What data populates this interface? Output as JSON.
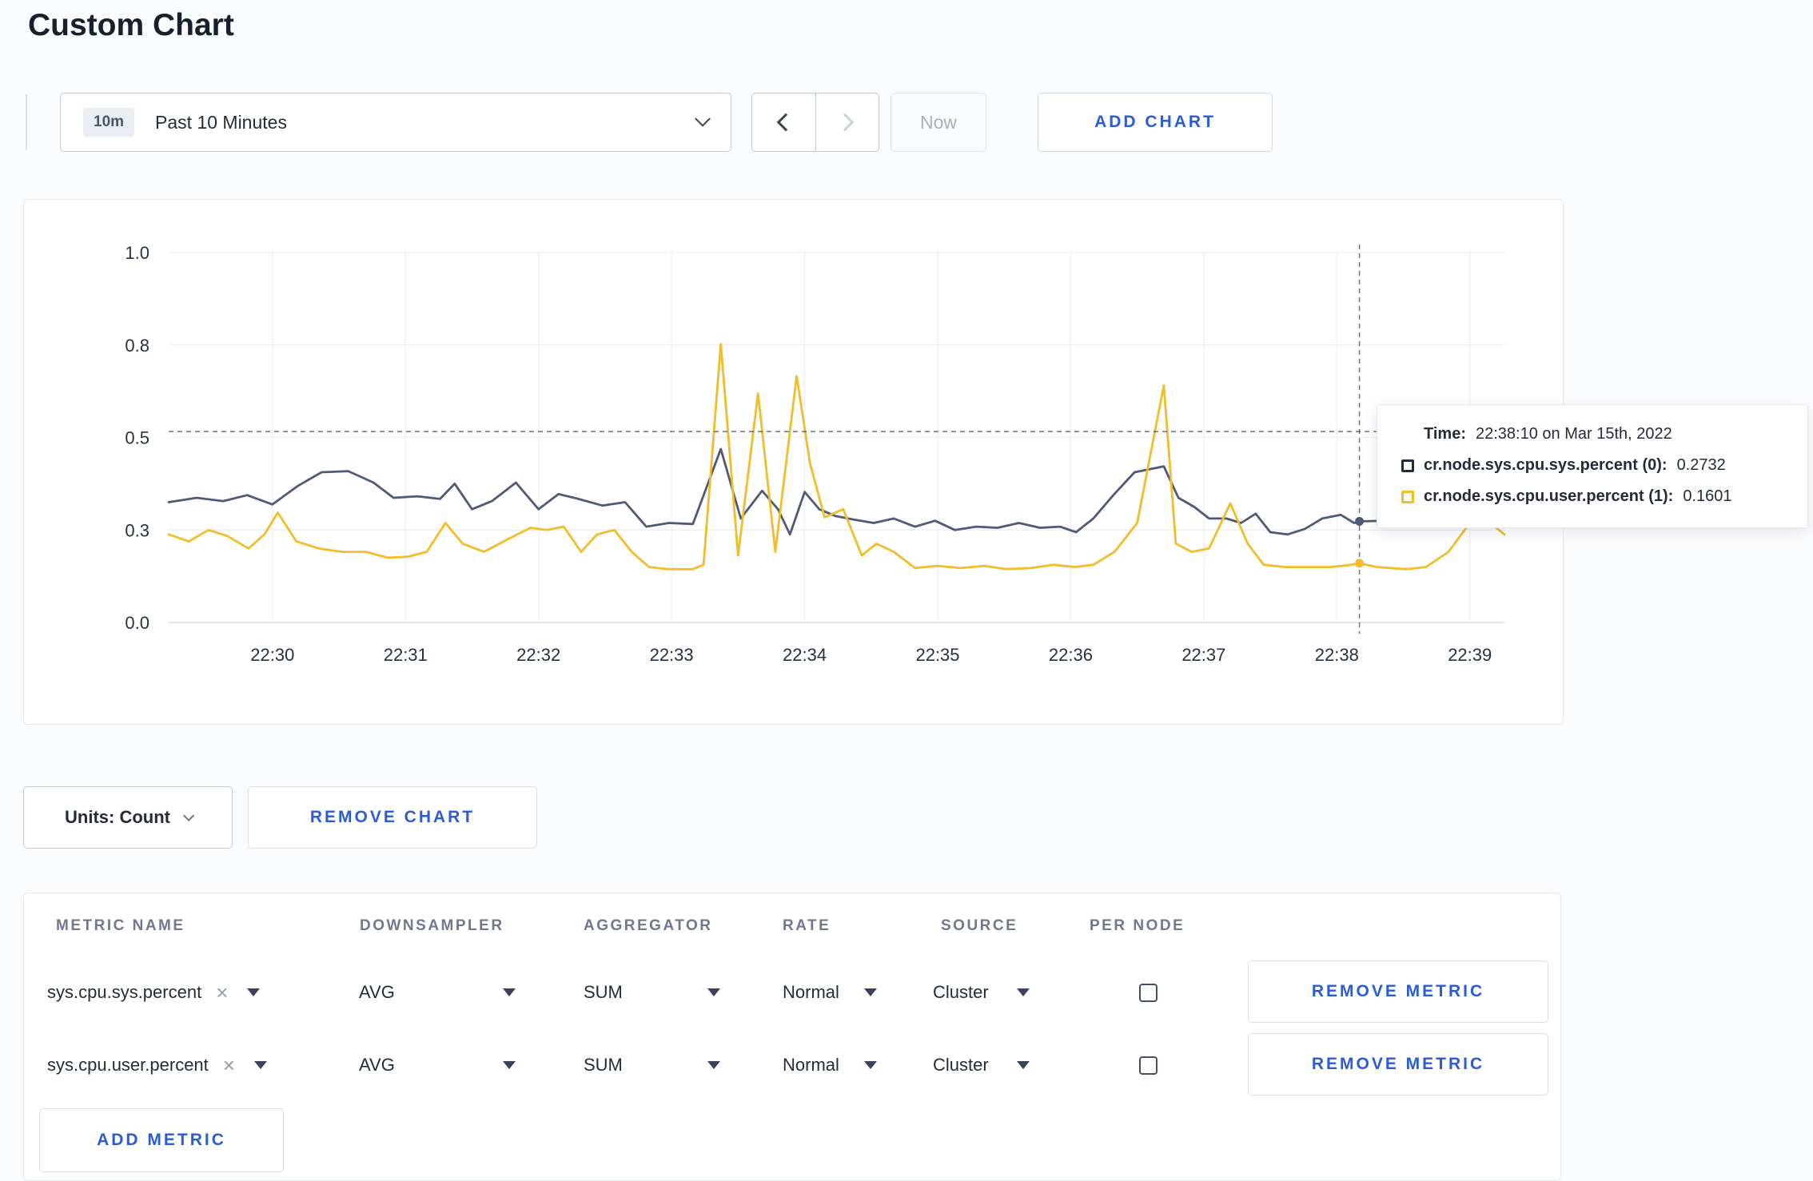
{
  "page": {
    "title": "Custom Chart"
  },
  "colors": {
    "accent": "#2b5bd7",
    "series_sys": "#4e5a78",
    "series_user": "#f2bd2a"
  },
  "toolbar": {
    "time_range": {
      "badge": "10m",
      "label": "Past 10 Minutes"
    },
    "now_label": "Now",
    "add_chart_label": "ADD CHART"
  },
  "chart": {
    "tooltip": {
      "time_label": "Time:",
      "time_value": "22:38:10 on Mar 15th, 2022",
      "series": [
        {
          "label": "cr.node.sys.cpu.sys.percent (0):",
          "value": "0.2732"
        },
        {
          "label": "cr.node.sys.cpu.user.percent (1):",
          "value": "0.1601"
        }
      ]
    }
  },
  "chart_data": {
    "type": "line",
    "title": "",
    "x_ticks": [
      "22:30",
      "22:31",
      "22:32",
      "22:33",
      "22:34",
      "22:35",
      "22:36",
      "22:37",
      "22:38",
      "22:39"
    ],
    "x_domain_minutes": [
      -0.78,
      9.26
    ],
    "y_domain": [
      0,
      1
    ],
    "y_ticks": {
      "values": [
        0,
        0.25,
        0.5,
        0.75,
        1.0
      ],
      "labels": [
        "0.0",
        "0.3",
        "0.5",
        "0.8",
        "1.0"
      ]
    },
    "grid": true,
    "series": [
      {
        "name": "cr.node.sys.cpu.sys.percent",
        "color": "#4e5a78",
        "points": [
          [
            -0.78,
            0.325
          ],
          [
            -0.57,
            0.337
          ],
          [
            -0.37,
            0.328
          ],
          [
            -0.19,
            0.344
          ],
          [
            0,
            0.319
          ],
          [
            0.19,
            0.369
          ],
          [
            0.37,
            0.406
          ],
          [
            0.57,
            0.409
          ],
          [
            0.76,
            0.378
          ],
          [
            0.91,
            0.337
          ],
          [
            1.09,
            0.341
          ],
          [
            1.26,
            0.334
          ],
          [
            1.37,
            0.375
          ],
          [
            1.5,
            0.306
          ],
          [
            1.65,
            0.328
          ],
          [
            1.83,
            0.378
          ],
          [
            2,
            0.306
          ],
          [
            2.15,
            0.347
          ],
          [
            2.3,
            0.334
          ],
          [
            2.48,
            0.316
          ],
          [
            2.65,
            0.325
          ],
          [
            2.81,
            0.259
          ],
          [
            2.98,
            0.269
          ],
          [
            3.16,
            0.266
          ],
          [
            3.37,
            0.469
          ],
          [
            3.52,
            0.281
          ],
          [
            3.68,
            0.356
          ],
          [
            3.8,
            0.306
          ],
          [
            3.89,
            0.238
          ],
          [
            4,
            0.353
          ],
          [
            4.11,
            0.306
          ],
          [
            4.23,
            0.288
          ],
          [
            4.37,
            0.278
          ],
          [
            4.52,
            0.269
          ],
          [
            4.67,
            0.281
          ],
          [
            4.83,
            0.259
          ],
          [
            4.98,
            0.275
          ],
          [
            5.13,
            0.25
          ],
          [
            5.29,
            0.259
          ],
          [
            5.45,
            0.256
          ],
          [
            5.61,
            0.269
          ],
          [
            5.77,
            0.256
          ],
          [
            5.92,
            0.259
          ],
          [
            6.04,
            0.244
          ],
          [
            6.17,
            0.281
          ],
          [
            6.32,
            0.344
          ],
          [
            6.48,
            0.406
          ],
          [
            6.7,
            0.422
          ],
          [
            6.81,
            0.337
          ],
          [
            6.93,
            0.312
          ],
          [
            7.04,
            0.281
          ],
          [
            7.17,
            0.281
          ],
          [
            7.28,
            0.269
          ],
          [
            7.39,
            0.294
          ],
          [
            7.5,
            0.244
          ],
          [
            7.63,
            0.238
          ],
          [
            7.76,
            0.253
          ],
          [
            7.89,
            0.281
          ],
          [
            8.03,
            0.291
          ],
          [
            8.13,
            0.269
          ],
          [
            8.17,
            0.2732
          ],
          [
            8.36,
            0.275
          ],
          [
            8.52,
            0.266
          ],
          [
            8.7,
            0.259
          ],
          [
            8.87,
            0.275
          ],
          [
            9,
            0.288
          ],
          [
            9.13,
            0.281
          ],
          [
            9.26,
            0.291
          ]
        ]
      },
      {
        "name": "cr.node.sys.cpu.user.percent",
        "color": "#f2bd2a",
        "points": [
          [
            -0.78,
            0.238
          ],
          [
            -0.63,
            0.219
          ],
          [
            -0.48,
            0.25
          ],
          [
            -0.34,
            0.234
          ],
          [
            -0.18,
            0.2
          ],
          [
            -0.06,
            0.238
          ],
          [
            0.04,
            0.297
          ],
          [
            0.18,
            0.219
          ],
          [
            0.35,
            0.2
          ],
          [
            0.52,
            0.191
          ],
          [
            0.7,
            0.191
          ],
          [
            0.87,
            0.175
          ],
          [
            1.02,
            0.178
          ],
          [
            1.16,
            0.191
          ],
          [
            1.3,
            0.269
          ],
          [
            1.43,
            0.213
          ],
          [
            1.59,
            0.191
          ],
          [
            1.77,
            0.225
          ],
          [
            1.94,
            0.256
          ],
          [
            2.06,
            0.25
          ],
          [
            2.19,
            0.259
          ],
          [
            2.32,
            0.191
          ],
          [
            2.44,
            0.238
          ],
          [
            2.57,
            0.25
          ],
          [
            2.7,
            0.191
          ],
          [
            2.83,
            0.15
          ],
          [
            2.98,
            0.144
          ],
          [
            3.16,
            0.144
          ],
          [
            3.24,
            0.156
          ],
          [
            3.37,
            0.753
          ],
          [
            3.5,
            0.181
          ],
          [
            3.65,
            0.619
          ],
          [
            3.78,
            0.191
          ],
          [
            3.94,
            0.666
          ],
          [
            4.04,
            0.431
          ],
          [
            4.15,
            0.284
          ],
          [
            4.29,
            0.306
          ],
          [
            4.43,
            0.181
          ],
          [
            4.54,
            0.213
          ],
          [
            4.67,
            0.191
          ],
          [
            4.83,
            0.147
          ],
          [
            5,
            0.153
          ],
          [
            5.17,
            0.147
          ],
          [
            5.35,
            0.153
          ],
          [
            5.52,
            0.144
          ],
          [
            5.7,
            0.147
          ],
          [
            5.87,
            0.156
          ],
          [
            6.03,
            0.15
          ],
          [
            6.17,
            0.156
          ],
          [
            6.33,
            0.191
          ],
          [
            6.5,
            0.269
          ],
          [
            6.7,
            0.641
          ],
          [
            6.79,
            0.213
          ],
          [
            6.91,
            0.191
          ],
          [
            7.04,
            0.2
          ],
          [
            7.2,
            0.322
          ],
          [
            7.33,
            0.213
          ],
          [
            7.45,
            0.156
          ],
          [
            7.61,
            0.15
          ],
          [
            7.78,
            0.15
          ],
          [
            7.96,
            0.15
          ],
          [
            8.11,
            0.156
          ],
          [
            8.17,
            0.1601
          ],
          [
            8.3,
            0.15
          ],
          [
            8.52,
            0.144
          ],
          [
            8.67,
            0.15
          ],
          [
            8.84,
            0.191
          ],
          [
            9,
            0.269
          ],
          [
            9.13,
            0.275
          ],
          [
            9.26,
            0.238
          ]
        ]
      }
    ],
    "crosshair": {
      "t": 8.17,
      "y_value": 0.516,
      "points": [
        {
          "t": 8.17,
          "v": 0.2732
        },
        {
          "t": 8.17,
          "v": 0.1601
        }
      ]
    }
  },
  "controls": {
    "units_label": "Units: Count",
    "remove_chart_label": "REMOVE CHART",
    "add_metric_label": "ADD METRIC"
  },
  "table": {
    "headers": [
      "METRIC NAME",
      "DOWNSAMPLER",
      "AGGREGATOR",
      "RATE",
      "SOURCE",
      "PER NODE"
    ],
    "rows": [
      {
        "metric": "sys.cpu.sys.percent",
        "downsampler": "AVG",
        "aggregator": "SUM",
        "rate": "Normal",
        "source": "Cluster",
        "per_node": false,
        "remove_label": "REMOVE METRIC"
      },
      {
        "metric": "sys.cpu.user.percent",
        "downsampler": "AVG",
        "aggregator": "SUM",
        "rate": "Normal",
        "source": "Cluster",
        "per_node": false,
        "remove_label": "REMOVE METRIC"
      }
    ]
  }
}
